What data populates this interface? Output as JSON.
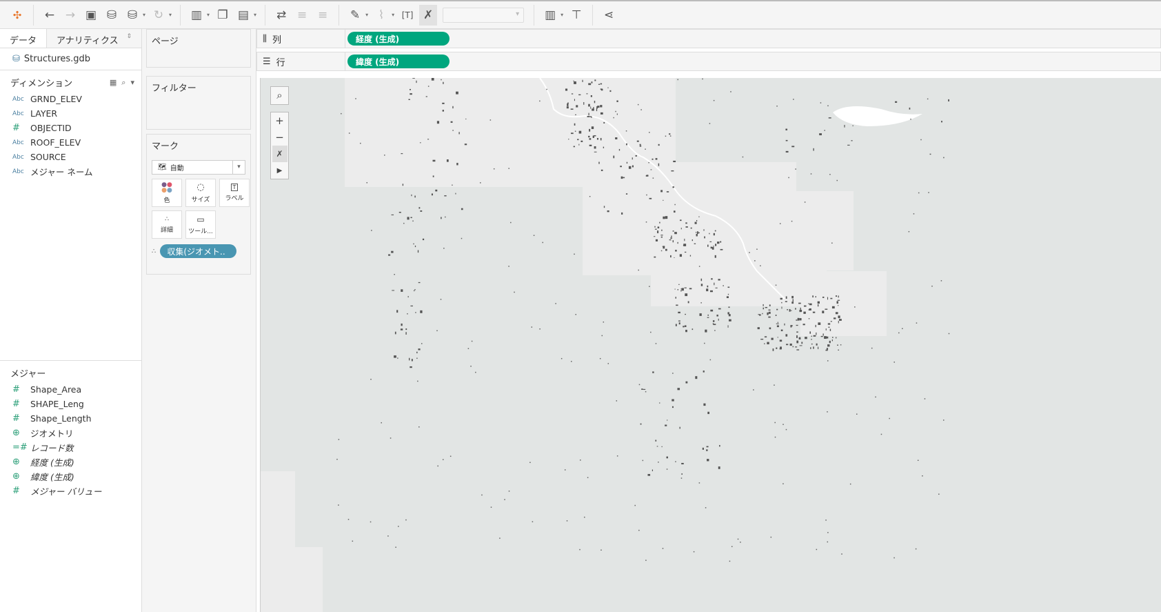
{
  "toolbar": {
    "icons": [
      "tableau-logo-icon",
      "undo-icon",
      "redo-icon",
      "save-icon",
      "new-datasource-icon",
      "pause-updates-icon",
      "refresh-icon",
      "new-worksheet-icon",
      "duplicate-sheet-icon",
      "clear-sheet-icon",
      "swap-icon",
      "sort-ascending-icon",
      "sort-descending-icon",
      "highlight-icon",
      "group-icon",
      "show-labels-icon",
      "pin-clear-icon",
      "fit-select",
      "show-me-icon",
      "presentation-icon",
      "share-icon"
    ]
  },
  "left": {
    "tabs": {
      "data": "データ",
      "analytics": "アナリティクス"
    },
    "datasource": "Structures.gdb",
    "dimensions_title": "ディメンション",
    "dimensions": [
      {
        "type": "Abc",
        "name": "GRND_ELEV"
      },
      {
        "type": "Abc",
        "name": "LAYER"
      },
      {
        "type": "#",
        "name": "OBJECTID"
      },
      {
        "type": "Abc",
        "name": "ROOF_ELEV"
      },
      {
        "type": "Abc",
        "name": "SOURCE"
      },
      {
        "type": "Abc",
        "name": "メジャー ネーム"
      }
    ],
    "measures_title": "メジャー",
    "measures": [
      {
        "type": "#",
        "name": "Shape_Area",
        "italic": false
      },
      {
        "type": "#",
        "name": "SHAPE_Leng",
        "italic": false
      },
      {
        "type": "#",
        "name": "Shape_Length",
        "italic": false
      },
      {
        "type": "geo",
        "name": "ジオメトリ",
        "italic": false
      },
      {
        "type": "=#",
        "name": "レコード数",
        "italic": true
      },
      {
        "type": "geo",
        "name": "経度 (生成)",
        "italic": true
      },
      {
        "type": "geo",
        "name": "緯度 (生成)",
        "italic": true
      },
      {
        "type": "#",
        "name": "メジャー バリュー",
        "italic": true
      }
    ]
  },
  "cards": {
    "pages": "ページ",
    "filters": "フィルター",
    "marks": {
      "title": "マーク",
      "type": "自動",
      "buttons": [
        "色",
        "サイズ",
        "ラベル",
        "詳細",
        "ツール..."
      ],
      "detail_pill": "収集(ジオメト.."
    }
  },
  "shelves": {
    "columns": {
      "label": "列",
      "pill": "経度 (生成)"
    },
    "rows": {
      "label": "行",
      "pill": "緯度 (生成)"
    }
  },
  "map": {
    "controls": [
      "search-icon",
      "zoom-in-icon",
      "zoom-out-icon",
      "pin-clear-icon",
      "expand-icon"
    ],
    "land_color": "#e2e5e4",
    "tile_color": "#ececec",
    "mark_color": "#555555"
  }
}
